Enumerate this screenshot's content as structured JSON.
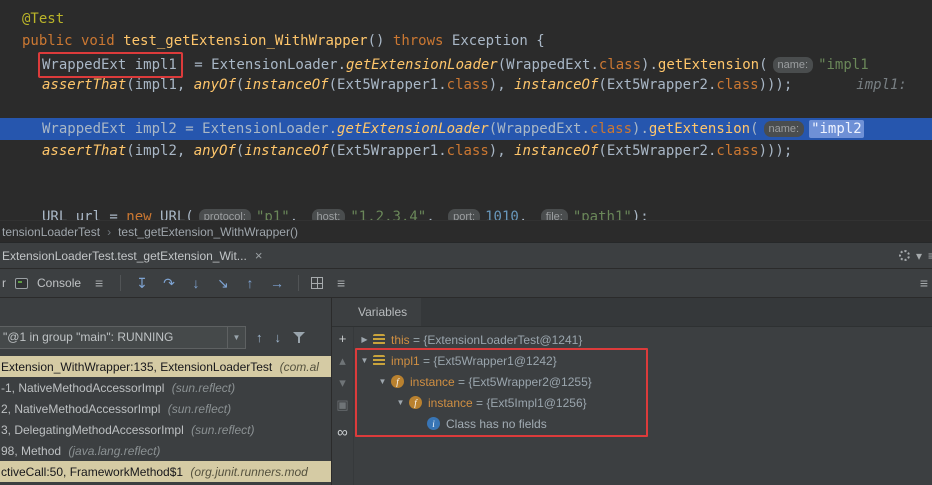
{
  "editor": {
    "lines": [
      {
        "indent": 1,
        "segments": [
          {
            "t": "@Test",
            "c": "ann"
          }
        ]
      },
      {
        "indent": 1,
        "segments": [
          {
            "t": "public void ",
            "c": "kw"
          },
          {
            "t": "test_getExtension_WithWrapper",
            "c": "method"
          },
          {
            "t": "() ",
            "c": "plain"
          },
          {
            "t": "throws ",
            "c": "kw"
          },
          {
            "t": "Exception {",
            "c": "plain"
          }
        ]
      },
      {
        "indent": 2,
        "segments": [
          {
            "t": "WrappedExt impl1",
            "c": "plain",
            "box": true
          },
          {
            "t": " = ExtensionLoader.",
            "c": "plain"
          },
          {
            "t": "getExtensionLoader",
            "c": "static"
          },
          {
            "t": "(WrappedExt.",
            "c": "plain"
          },
          {
            "t": "class",
            "c": "kw"
          },
          {
            "t": ").",
            "c": "plain"
          },
          {
            "t": "getExtension",
            "c": "method"
          },
          {
            "t": "(",
            "c": "plain"
          },
          {
            "t": "name:",
            "c": "hint"
          },
          {
            "t": "\"impl1",
            "c": "string"
          }
        ]
      },
      {
        "indent": 2,
        "segments": [
          {
            "t": "assertThat",
            "c": "static"
          },
          {
            "t": "(impl1, ",
            "c": "plain"
          },
          {
            "t": "anyOf",
            "c": "static"
          },
          {
            "t": "(",
            "c": "plain"
          },
          {
            "t": "instanceOf",
            "c": "static"
          },
          {
            "t": "(Ext5Wrapper1.",
            "c": "plain"
          },
          {
            "t": "class",
            "c": "kw"
          },
          {
            "t": "), ",
            "c": "plain"
          },
          {
            "t": "instanceOf",
            "c": "static"
          },
          {
            "t": "(Ext5Wrapper2.",
            "c": "plain"
          },
          {
            "t": "class",
            "c": "kw"
          },
          {
            "t": ")));",
            "c": "plain"
          },
          {
            "t": "impl1:",
            "c": "dbg"
          }
        ]
      },
      {
        "indent": 2,
        "segments": []
      },
      {
        "indent": 2,
        "cls": "exec",
        "segments": [
          {
            "t": "WrappedExt impl2 = ExtensionLoader.",
            "c": "plain"
          },
          {
            "t": "getExtensionLoader",
            "c": "static"
          },
          {
            "t": "(WrappedExt.",
            "c": "plain"
          },
          {
            "t": "class",
            "c": "kw"
          },
          {
            "t": ").",
            "c": "plain"
          },
          {
            "t": "getExtension",
            "c": "method"
          },
          {
            "t": "(",
            "c": "plain"
          },
          {
            "t": "name:",
            "c": "hint"
          },
          {
            "t": "\"impl2",
            "c": "stringsel"
          }
        ]
      },
      {
        "indent": 2,
        "segments": [
          {
            "t": "assertThat",
            "c": "static"
          },
          {
            "t": "(impl2, ",
            "c": "plain"
          },
          {
            "t": "anyOf",
            "c": "static"
          },
          {
            "t": "(",
            "c": "plain"
          },
          {
            "t": "instanceOf",
            "c": "static"
          },
          {
            "t": "(Ext5Wrapper1.",
            "c": "plain"
          },
          {
            "t": "class",
            "c": "kw"
          },
          {
            "t": "), ",
            "c": "plain"
          },
          {
            "t": "instanceOf",
            "c": "static"
          },
          {
            "t": "(Ext5Wrapper2.",
            "c": "plain"
          },
          {
            "t": "class",
            "c": "kw"
          },
          {
            "t": ")));",
            "c": "plain"
          }
        ]
      },
      {
        "indent": 2,
        "segments": []
      },
      {
        "indent": 2,
        "segments": []
      },
      {
        "indent": 2,
        "segments": [
          {
            "t": "URL url = ",
            "c": "plain"
          },
          {
            "t": "new ",
            "c": "kw"
          },
          {
            "t": "URL(",
            "c": "plain"
          },
          {
            "t": "protocol:",
            "c": "hint"
          },
          {
            "t": "\"p1\"",
            "c": "string"
          },
          {
            "t": ", ",
            "c": "plain"
          },
          {
            "t": "host:",
            "c": "hint"
          },
          {
            "t": "\"1.2.3.4\"",
            "c": "string"
          },
          {
            "t": ", ",
            "c": "plain"
          },
          {
            "t": "port:",
            "c": "hint"
          },
          {
            "t": "1010",
            "c": "num"
          },
          {
            "t": ", ",
            "c": "plain"
          },
          {
            "t": "file:",
            "c": "hint"
          },
          {
            "t": "\"path1\"",
            "c": "string"
          },
          {
            "t": ");",
            "c": "plain"
          }
        ]
      }
    ]
  },
  "breadcrumbs": {
    "separator": "›",
    "items": [
      "tensionLoaderTest",
      "test_getExtension_WithWrapper()"
    ]
  },
  "debug_tab": {
    "title": "ExtensionLoaderTest.test_getExtension_Wit...",
    "close_glyph": "×",
    "right_icons": [
      {
        "name": "settings-gear-icon",
        "type": "gear"
      },
      {
        "name": "chevron-down-icon",
        "glyph": "▾"
      },
      {
        "name": "panel-options-icon",
        "glyph": "≡",
        "cls": "cut"
      }
    ]
  },
  "toolbar": {
    "clipped_left": "r",
    "console_label": "Console",
    "icons": [
      {
        "name": "layout-settings-icon",
        "glyph": "≡",
        "cls": "gray"
      },
      {
        "name": "toolbar-separator"
      },
      {
        "name": "show-execution-point-icon",
        "glyph": "↧",
        "cls": "blue"
      },
      {
        "name": "step-over-icon",
        "glyph": "↷",
        "cls": "blue"
      },
      {
        "name": "step-into-icon",
        "glyph": "↓",
        "cls": "blue"
      },
      {
        "name": "force-step-into-icon",
        "glyph": "↘",
        "cls": "blue"
      },
      {
        "name": "step-out-icon",
        "glyph": "↑",
        "cls": "blue"
      },
      {
        "name": "run-to-cursor-icon",
        "glyph": "→",
        "cls": "blue"
      },
      {
        "name": "toolbar-separator"
      },
      {
        "name": "view-as-grid-icon",
        "type": "grid"
      },
      {
        "name": "threads-view-icon",
        "glyph": "≡",
        "cls": "gray"
      }
    ],
    "right_icon": {
      "name": "toolbar-more-icon",
      "glyph": "≡"
    }
  },
  "frames_panel": {
    "thread_dropdown_text": "\"@1 in group \"main\": RUNNING",
    "dropdown_arrow": "▼",
    "controls": [
      {
        "name": "previous-frame-icon",
        "glyph": "↑"
      },
      {
        "name": "next-frame-icon",
        "glyph": "↓"
      },
      {
        "name": "filter-frames-icon",
        "type": "funnel"
      }
    ],
    "frames": [
      {
        "loc": "Extension_WithWrapper:135, ExtensionLoaderTest ",
        "pkg": "(com.al",
        "selected": true
      },
      {
        "loc": "-1, NativeMethodAccessorImpl ",
        "pkg": "(sun.reflect)",
        "selected": false
      },
      {
        "loc": "2, NativeMethodAccessorImpl ",
        "pkg": "(sun.reflect)",
        "selected": false
      },
      {
        "loc": "3, DelegatingMethodAccessorImpl ",
        "pkg": "(sun.reflect)",
        "selected": false
      },
      {
        "loc": "98, Method ",
        "pkg": "(java.lang.reflect)",
        "selected": false
      },
      {
        "loc": "ctiveCall:50, FrameworkMethod$1 ",
        "pkg": "(org.junit.runners.mod",
        "selected": true
      }
    ]
  },
  "variables_panel": {
    "tab_label": "Variables",
    "toolbar_icons": [
      {
        "name": "add-watch-icon",
        "glyph": "+",
        "cls": "bright"
      },
      {
        "name": "collapse-all-icon",
        "glyph": "▴",
        "cls": "dim mt"
      },
      {
        "name": "expand-all-icon",
        "glyph": "▾",
        "cls": "dim"
      },
      {
        "name": "copy-value-icon",
        "glyph": "▣",
        "cls": "dim"
      },
      {
        "name": "evaluate-expression-icon",
        "glyph": "∞",
        "cls": "bright big"
      }
    ],
    "rows": [
      {
        "level": 0,
        "state": "collapsed",
        "icon": "var",
        "name": "this",
        "value": "= {ExtensionLoaderTest@1241}"
      },
      {
        "level": 0,
        "state": "expanded",
        "icon": "var",
        "name": "impl1",
        "value": "= {Ext5Wrapper1@1242}"
      },
      {
        "level": 1,
        "state": "expanded",
        "icon": "field",
        "name": "instance",
        "value": "= {Ext5Wrapper2@1255}"
      },
      {
        "level": 2,
        "state": "expanded",
        "icon": "field",
        "name": "instance",
        "value": "= {Ext5Impl1@1256}"
      },
      {
        "level": 3,
        "state": "none",
        "icon": "info",
        "name": "",
        "value": "Class has no fields"
      }
    ]
  }
}
